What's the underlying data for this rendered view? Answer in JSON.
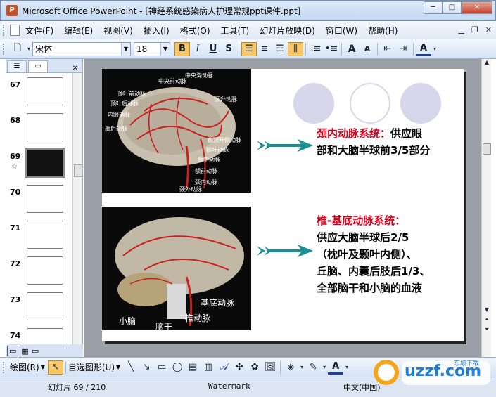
{
  "window": {
    "title": "Microsoft Office PowerPoint - [神经系统感染病人护理常规ppt课件.ppt]"
  },
  "menu": [
    "文件(F)",
    "编辑(E)",
    "视图(V)",
    "插入(I)",
    "格式(O)",
    "工具(T)",
    "幻灯片放映(D)",
    "窗口(W)",
    "帮助(H)"
  ],
  "toolbar": {
    "font": "宋体",
    "size": "18",
    "bold": "B",
    "italic": "I",
    "underline": "U",
    "shadow": "S",
    "grow_font": "A",
    "shrink_font": "A",
    "font_color": "A"
  },
  "slides": [
    {
      "num": "67",
      "selected": false
    },
    {
      "num": "68",
      "selected": false
    },
    {
      "num": "69",
      "selected": true,
      "mark": "☆"
    },
    {
      "num": "70",
      "selected": false
    },
    {
      "num": "71",
      "selected": false
    },
    {
      "num": "72",
      "selected": false
    },
    {
      "num": "73",
      "selected": false
    },
    {
      "num": "74",
      "selected": false
    }
  ],
  "slide": {
    "section1_title": "颈内动脉系统：",
    "section1_rest": "供应眼",
    "section1_line2": "部和大脑半球前3/5部分",
    "section2_title": "椎-基底动脉系统：",
    "section2_lines": [
      "供应大脑半球后2/5",
      "（枕叶及颞叶内侧）、",
      "丘脑、内囊后肢后1/3、",
      "全部脑干和小脑的血液"
    ],
    "brain1_labels": [
      "中央前动脉",
      "顶叶前动脉",
      "中央沟动脉",
      "顶叶后动脉",
      "顶升动脉",
      "内眼动脉",
      "颞后动脉",
      "额顶升侧动脉",
      "额叶动脉",
      "颞中动脉",
      "额前动脉",
      "颈内动脉",
      "颈外动脉"
    ],
    "brain2_labels": [
      "基底动脉",
      "小脑",
      "椎动脉",
      "脑干"
    ],
    "colors": {
      "title_red": "#d0021b",
      "arrow": "#1a8f96",
      "circle": "#d8d6ea"
    }
  },
  "drawbar": {
    "draw": "绘图(R)",
    "autoshape": "自选图形(U)"
  },
  "status": {
    "slide_info": "幻灯片 69 / 210",
    "design": "Watermark",
    "language": "中文(中国)"
  },
  "watermark_logo": {
    "text": "uzzf.com",
    "sub": "东坡下载"
  }
}
